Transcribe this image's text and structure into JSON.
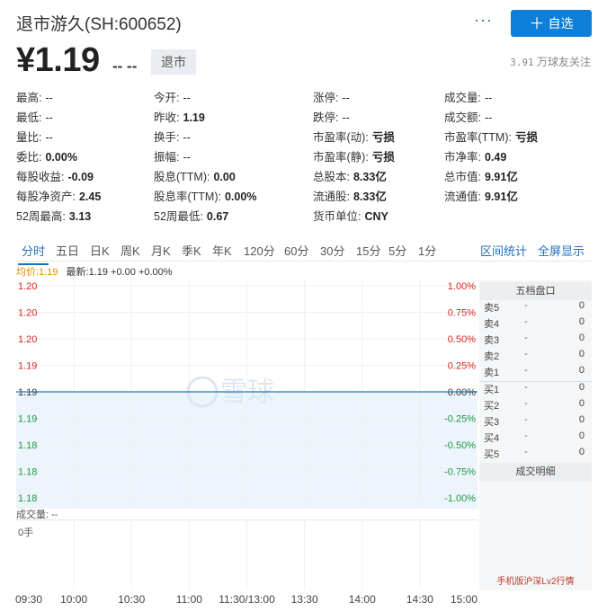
{
  "header": {
    "title": "退市游久(SH:600652)",
    "more_label": "···",
    "add_label": "自选",
    "add_icon": "plus-icon",
    "price": "¥1.19",
    "change": "-- --",
    "status_badge": "退市",
    "followers_count": "3.91",
    "followers_unit": "万球友关注"
  },
  "stats": [
    {
      "label": "最高:",
      "value": "--",
      "bold": false
    },
    {
      "label": "今开:",
      "value": "--",
      "bold": false
    },
    {
      "label": "涨停:",
      "value": "--",
      "bold": false
    },
    {
      "label": "成交量:",
      "value": "--",
      "bold": false
    },
    {
      "label": "最低:",
      "value": "--",
      "bold": false
    },
    {
      "label": "昨收:",
      "value": "1.19",
      "bold": true
    },
    {
      "label": "跌停:",
      "value": "--",
      "bold": false
    },
    {
      "label": "成交额:",
      "value": "--",
      "bold": false
    },
    {
      "label": "量比:",
      "value": "--",
      "bold": false
    },
    {
      "label": "换手:",
      "value": "--",
      "bold": false
    },
    {
      "label": "市盈率(动):",
      "value": "亏损",
      "bold": true
    },
    {
      "label": "市盈率(TTM):",
      "value": "亏损",
      "bold": true
    },
    {
      "label": "委比:",
      "value": "0.00%",
      "bold": true
    },
    {
      "label": "振幅:",
      "value": "--",
      "bold": false
    },
    {
      "label": "市盈率(静):",
      "value": "亏损",
      "bold": true
    },
    {
      "label": "市净率:",
      "value": "0.49",
      "bold": true
    },
    {
      "label": "每股收益:",
      "value": "-0.09",
      "bold": true
    },
    {
      "label": "股息(TTM):",
      "value": "0.00",
      "bold": true
    },
    {
      "label": "总股本:",
      "value": "8.33亿",
      "bold": true
    },
    {
      "label": "总市值:",
      "value": "9.91亿",
      "bold": true
    },
    {
      "label": "每股净资产:",
      "value": "2.45",
      "bold": true
    },
    {
      "label": "股息率(TTM):",
      "value": "0.00%",
      "bold": true
    },
    {
      "label": "流通股:",
      "value": "8.33亿",
      "bold": true
    },
    {
      "label": "流通值:",
      "value": "9.91亿",
      "bold": true
    },
    {
      "label": "52周最高:",
      "value": "3.13",
      "bold": true
    },
    {
      "label": "52周最低:",
      "value": "0.67",
      "bold": true
    },
    {
      "label": "货币单位:",
      "value": "CNY",
      "bold": true
    }
  ],
  "tabs": [
    "分时",
    "五日",
    "日K",
    "周K",
    "月K",
    "季K",
    "年K",
    "120分",
    "60分",
    "30分",
    "15分",
    "5分",
    "1分"
  ],
  "active_tab": "分时",
  "links": [
    "区间统计",
    "全屏显示"
  ],
  "avg_line": {
    "label": "均价:1.19",
    "latest": "最新:1.19 +0.00 +0.00%"
  },
  "colors": {
    "up": "#d6261f",
    "down": "#1a9a46",
    "accent": "#1f6fbf",
    "price_line": "#1f78b4",
    "avg": "#e28a00"
  },
  "chart_data": {
    "type": "line",
    "title": "",
    "x": [
      "09:30",
      "10:00",
      "10:30",
      "11:00",
      "11:30/13:00",
      "13:30",
      "14:00",
      "14:30",
      "15:00"
    ],
    "series": [
      {
        "values": [
          1.19,
          1.19,
          1.19,
          1.19,
          1.19,
          1.19,
          1.19,
          1.19,
          1.19
        ]
      }
    ],
    "ylim": [
      1.18,
      1.2
    ],
    "y_tick_labels_left": [
      "1.20",
      "1.20",
      "1.20",
      "1.19",
      "1.19",
      "1.19",
      "1.18",
      "1.18",
      "1.18"
    ],
    "y_tick_labels_right": [
      "1.00%",
      "0.75%",
      "0.50%",
      "0.25%",
      "0.00%",
      "-0.25%",
      "-0.50%",
      "-0.75%",
      "-1.00%"
    ],
    "grid": true,
    "watermark": "雪球"
  },
  "volume": {
    "label": "成交量: --",
    "zero": "0手"
  },
  "order_book": {
    "title": "五档盘口",
    "sell": [
      {
        "label": "卖5",
        "price": "-",
        "qty": "0"
      },
      {
        "label": "卖4",
        "price": "-",
        "qty": "0"
      },
      {
        "label": "卖3",
        "price": "-",
        "qty": "0"
      },
      {
        "label": "卖2",
        "price": "-",
        "qty": "0"
      },
      {
        "label": "卖1",
        "price": "-",
        "qty": "0"
      }
    ],
    "buy": [
      {
        "label": "买1",
        "price": "-",
        "qty": "0"
      },
      {
        "label": "买2",
        "price": "-",
        "qty": "0"
      },
      {
        "label": "买3",
        "price": "-",
        "qty": "0"
      },
      {
        "label": "买4",
        "price": "-",
        "qty": "0"
      },
      {
        "label": "买5",
        "price": "-",
        "qty": "0"
      }
    ],
    "detail_title": "成交明细",
    "footer": "手机版沪深Lv2行情"
  }
}
